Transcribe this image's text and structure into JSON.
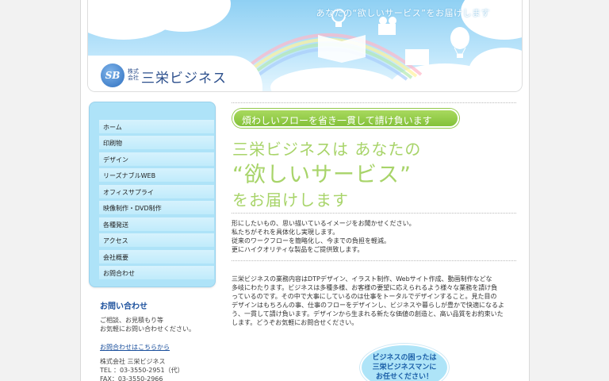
{
  "header": {
    "tagline": "あなたの“欲しいサービス”をお届けします",
    "logo_mark": "SB",
    "logo_small": "株式会社",
    "logo_text": "三栄ビジネス"
  },
  "nav": {
    "items": [
      {
        "label": "ホーム"
      },
      {
        "label": "印刷物"
      },
      {
        "label": "デザイン"
      },
      {
        "label": "リーズナブルWEB"
      },
      {
        "label": "オフィスサプライ"
      },
      {
        "label": "映像制作・DVD制作"
      },
      {
        "label": "各種発送"
      },
      {
        "label": "アクセス"
      },
      {
        "label": "会社概要"
      },
      {
        "label": "お問合わせ"
      }
    ]
  },
  "contact": {
    "title": "お問い合わせ",
    "line1": "ご相談、お見積もり等",
    "line2": "お気軽にお問い合わせください。",
    "link": "お問合わせはこちらから",
    "company": "株式会社 三栄ビジネス",
    "tel": "TEL ：03-3550-2951（代）",
    "fax": "FAX：03-3550-2966"
  },
  "main": {
    "badge": "煩わしいフローを省き一貫して請け負います",
    "hero_line1": "三栄ビジネスは あなたの",
    "hero_line2": "“欲しいサービス”",
    "hero_line3": "をお届けします",
    "intro": [
      "形にしたいもの、思い描いているイメージをお聞かせください。",
      "私たちがそれを具体化し実現します。",
      "従来のワークフローを簡略化し、今までの負担を軽減。",
      "更にハイクオリティな製品をご提供致します。"
    ],
    "body": [
      "三栄ビジネスの業務内容はDTPデザイン、イラスト制作、Webサイト作成、動画制作などな",
      "多岐にわたります。ビジネスは多種多様、お客様の要望に応えられるよう様々な業務を請け負",
      "っているのです。その中で大事にしているのは仕事をトータルでデザインすること。見た目の",
      "デザインはもちろんの事、仕事のフローをデザインし、ビジネスや暮らしが豊かで快適になるよ",
      "う、一貫して請け負います。デザインから生まれる新たな価値の創造と、高い品質をお約束いた",
      "します。どうぞお気軽にお問合せください。"
    ],
    "bubble_line1": "ビジネスの困ったは",
    "bubble_line2": "三栄ビジネスマンに",
    "bubble_line3": "お任せください！"
  },
  "colors": {
    "accent_green": "#a8d46a",
    "nav_blue": "#aee3f8",
    "link_blue": "#1a4f9c"
  }
}
